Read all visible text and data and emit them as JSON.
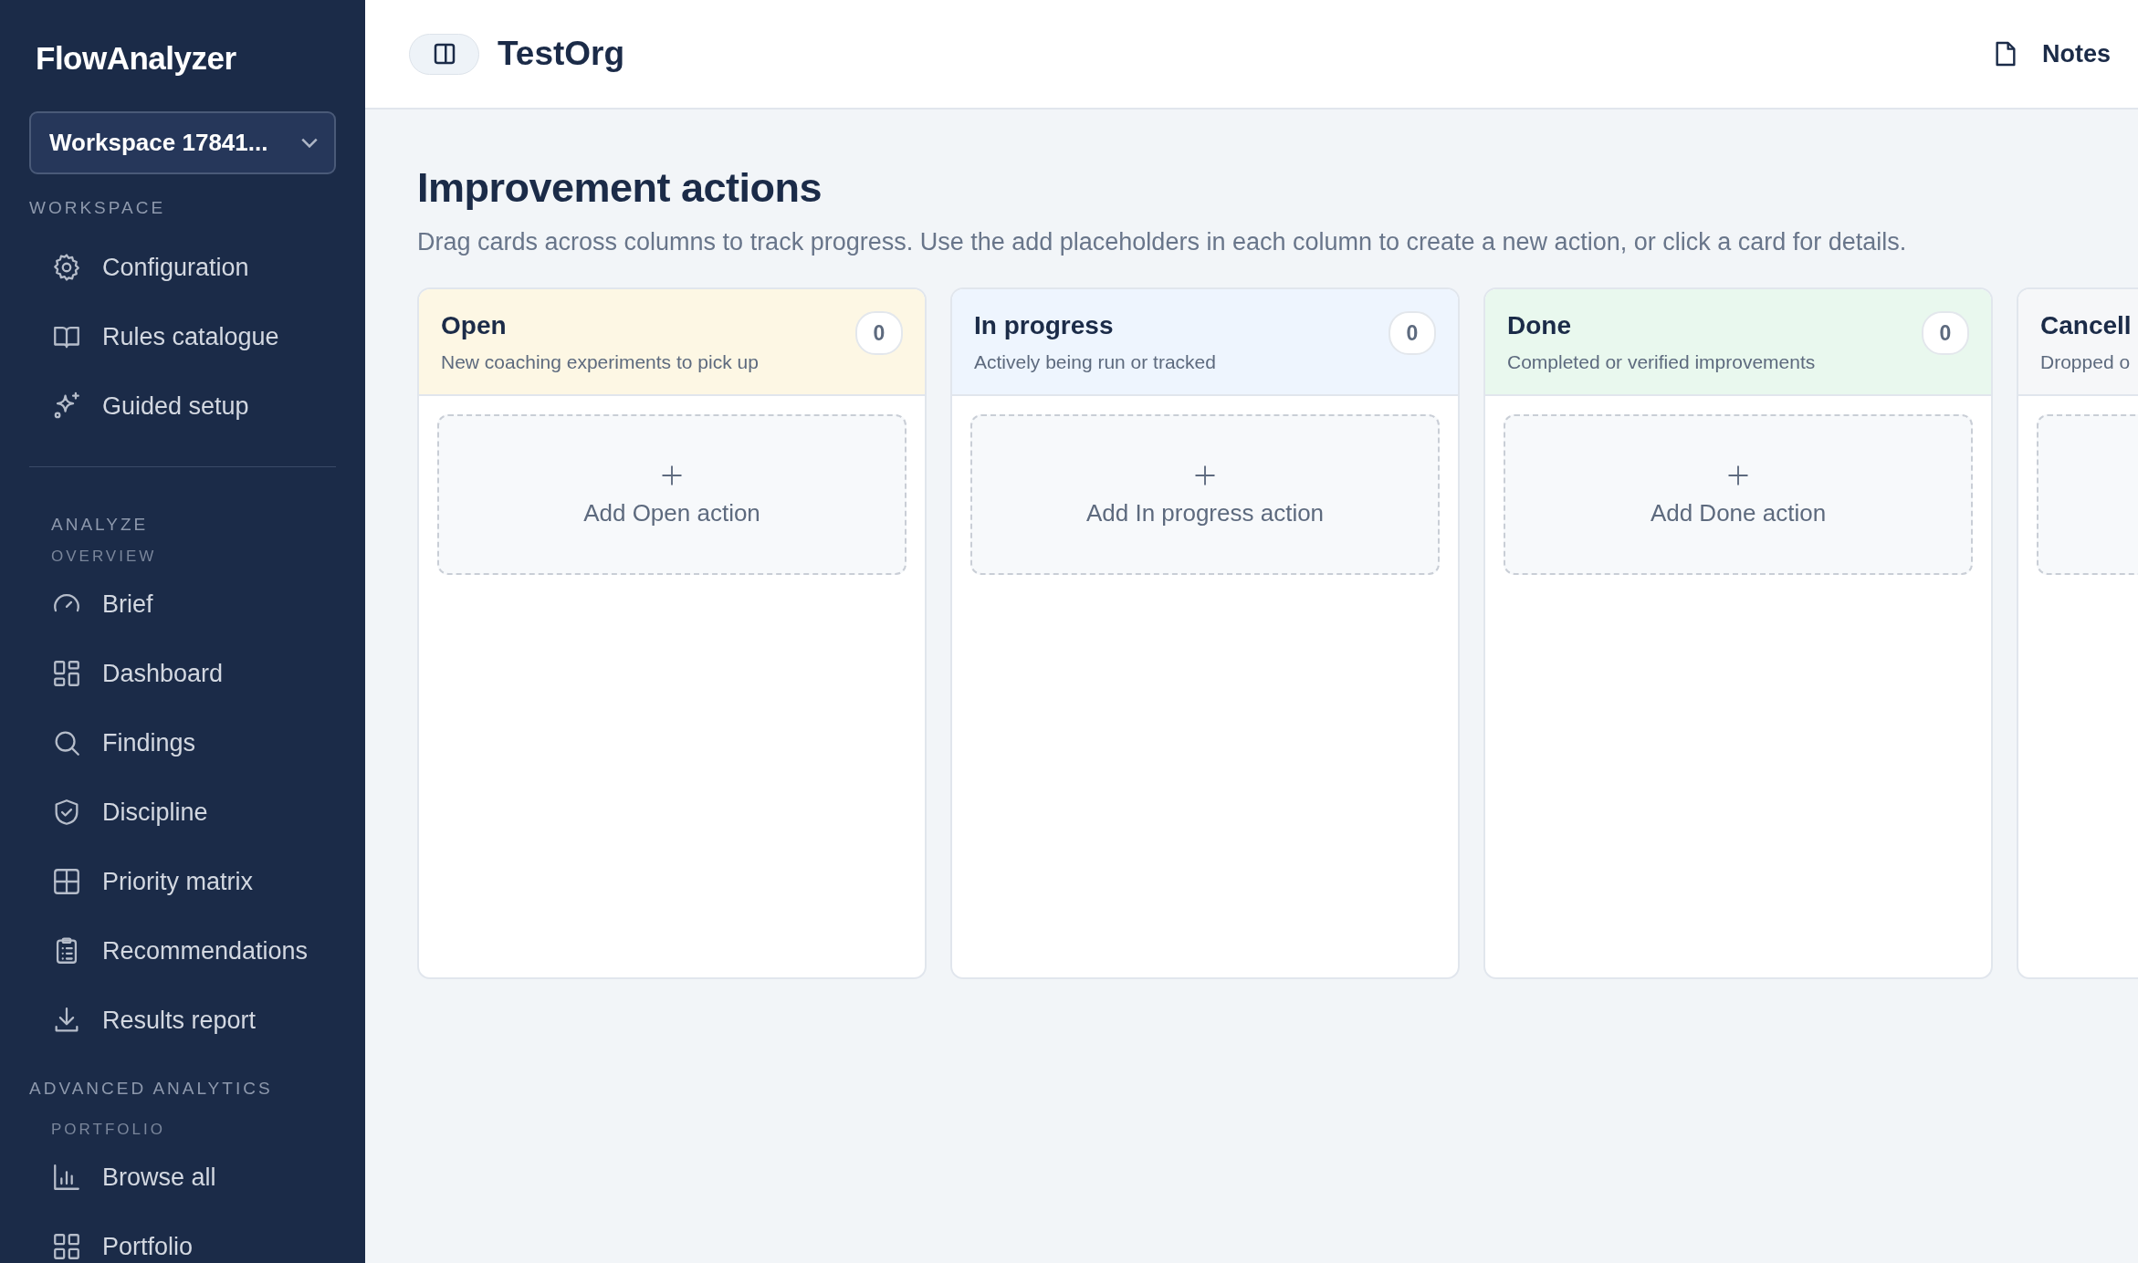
{
  "sidebar": {
    "brand": "FlowAnalyzer",
    "workspace_select": {
      "value": "Workspace 17841..."
    },
    "sections": [
      {
        "label": "WORKSPACE",
        "groups": [
          {
            "items": [
              "Configuration",
              "Rules catalogue",
              "Guided setup"
            ]
          }
        ]
      },
      {
        "label": "ANALYZE",
        "groups": [
          {
            "label": "OVERVIEW",
            "items": [
              "Brief",
              "Dashboard",
              "Findings",
              "Discipline",
              "Priority matrix",
              "Recommendations",
              "Results report"
            ]
          }
        ]
      },
      {
        "label": "ADVANCED ANALYTICS",
        "groups": [
          {
            "label": "PORTFOLIO",
            "items": [
              "Browse all",
              "Portfolio"
            ]
          }
        ]
      }
    ]
  },
  "header": {
    "title": "TestOrg",
    "notes_button": "Notes"
  },
  "page": {
    "title": "Improvement actions",
    "description": "Drag cards across columns to track progress. Use the add placeholders in each column to create a new action, or click a card for details."
  },
  "columns": [
    {
      "title": "Open",
      "subtitle": "New coaching experiments to pick up",
      "count": "0",
      "color": "#fdf7e4",
      "add_label": "Add Open action"
    },
    {
      "title": "In progress",
      "subtitle": "Actively being run or tracked",
      "count": "0",
      "color": "#eef5fe",
      "add_label": "Add In progress action"
    },
    {
      "title": "Done",
      "subtitle": "Completed or verified improvements",
      "count": "0",
      "color": "#e9f8ee",
      "add_label": "Add Done action"
    },
    {
      "title": "Cancell",
      "subtitle": "Dropped o",
      "color": "#f6f7f9"
    }
  ]
}
